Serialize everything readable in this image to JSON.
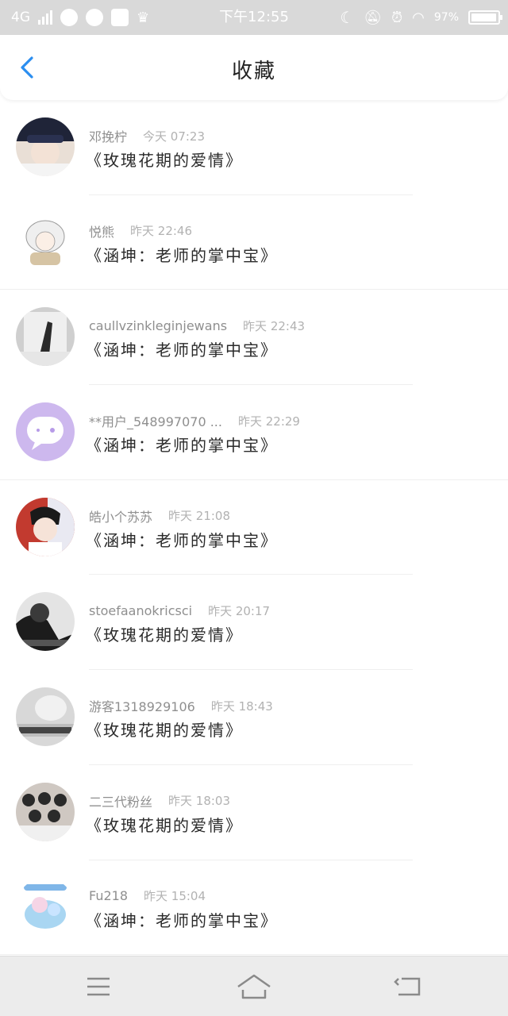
{
  "status_bar": {
    "network": "4G",
    "time": "下午12:55",
    "battery": "97%",
    "battery_level": 0.97
  },
  "header": {
    "title": "收藏",
    "back_icon": "chevron-left-icon",
    "accent_color": "#2b8ef0"
  },
  "favorites": [
    {
      "username": "邓挽柠",
      "time": "今天 07:23",
      "book": "《玫瑰花期的爱情》"
    },
    {
      "username": "悦熊",
      "time": "昨天 22:46",
      "book": "《涵坤：老师的掌中宝》"
    },
    {
      "username": "caullvzinkleginjewans",
      "time": "昨天 22:43",
      "book": "《涵坤：老师的掌中宝》"
    },
    {
      "username": "**用户_548997070 ...",
      "time": "昨天 22:29",
      "book": "《涵坤：老师的掌中宝》"
    },
    {
      "username": "皓小个苏苏",
      "time": "昨天 21:08",
      "book": "《涵坤：老师的掌中宝》"
    },
    {
      "username": "stoefaanokricsci",
      "time": "昨天 20:17",
      "book": "《玫瑰花期的爱情》"
    },
    {
      "username": "游客1318929106",
      "time": "昨天 18:43",
      "book": "《玫瑰花期的爱情》"
    },
    {
      "username": "二三代粉丝",
      "time": "昨天 18:03",
      "book": "《玫瑰花期的爱情》"
    },
    {
      "username": "Fu218",
      "time": "昨天 15:04",
      "book": "《涵坤：老师的掌中宝》"
    }
  ],
  "nav_bar": {
    "menu_icon": "menu-icon",
    "home_icon": "home-icon",
    "back_icon": "back-arrow-icon"
  }
}
